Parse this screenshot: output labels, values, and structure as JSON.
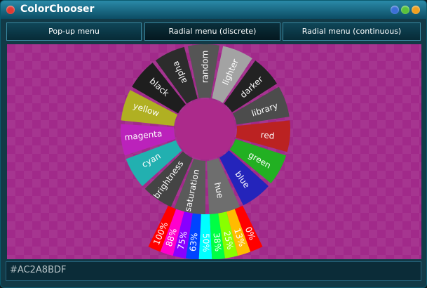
{
  "window": {
    "title": "ColorChooser",
    "controls": {
      "close_color": "#e03a32",
      "minimize_color": "#3b6fd6",
      "maximize_color": "#5ac23c",
      "fullscreen_color": "#f0a020"
    }
  },
  "menu": {
    "tabs": [
      {
        "label": "Pop-up menu"
      },
      {
        "label": "Radial menu (discrete)"
      },
      {
        "label": "Radial menu (continuous)"
      }
    ]
  },
  "radial": {
    "ring": [
      {
        "label": "alpha",
        "color": "#2c2c2c"
      },
      {
        "label": "random",
        "color": "#555555"
      },
      {
        "label": "lighter",
        "color": "#a3a3a3"
      },
      {
        "label": "darker",
        "color": "#222222"
      },
      {
        "label": "library",
        "color": "#4c4c4c"
      },
      {
        "label": "red",
        "color": "#bb2222"
      },
      {
        "label": "green",
        "color": "#22b022"
      },
      {
        "label": "blue",
        "color": "#2424bb"
      },
      {
        "label": "hue",
        "color": "#6e6e6e"
      },
      {
        "label": "saturation",
        "color": "#5a5a5a"
      },
      {
        "label": "brightness",
        "color": "#444444"
      },
      {
        "label": "cyan",
        "color": "#22b0b0"
      },
      {
        "label": "magenta",
        "color": "#bb22bb"
      },
      {
        "label": "yellow",
        "color": "#b0b022"
      },
      {
        "label": "black",
        "color": "#1e1e1e"
      }
    ],
    "scale": [
      {
        "label": "100%",
        "color": "#ff0000"
      },
      {
        "label": "88%",
        "color": "#ff00cc"
      },
      {
        "label": "75%",
        "color": "#8800ff"
      },
      {
        "label": "63%",
        "color": "#0044ff"
      },
      {
        "label": "50%",
        "color": "#00ffff"
      },
      {
        "label": "38%",
        "color": "#00ff44"
      },
      {
        "label": "25%",
        "color": "#88ff00"
      },
      {
        "label": "13%",
        "color": "#ffbb00"
      },
      {
        "label": "0%",
        "color": "#ff0000"
      }
    ],
    "center_color": "#ac2a8b"
  },
  "status": {
    "hex_value": "#AC2A8BDF"
  }
}
